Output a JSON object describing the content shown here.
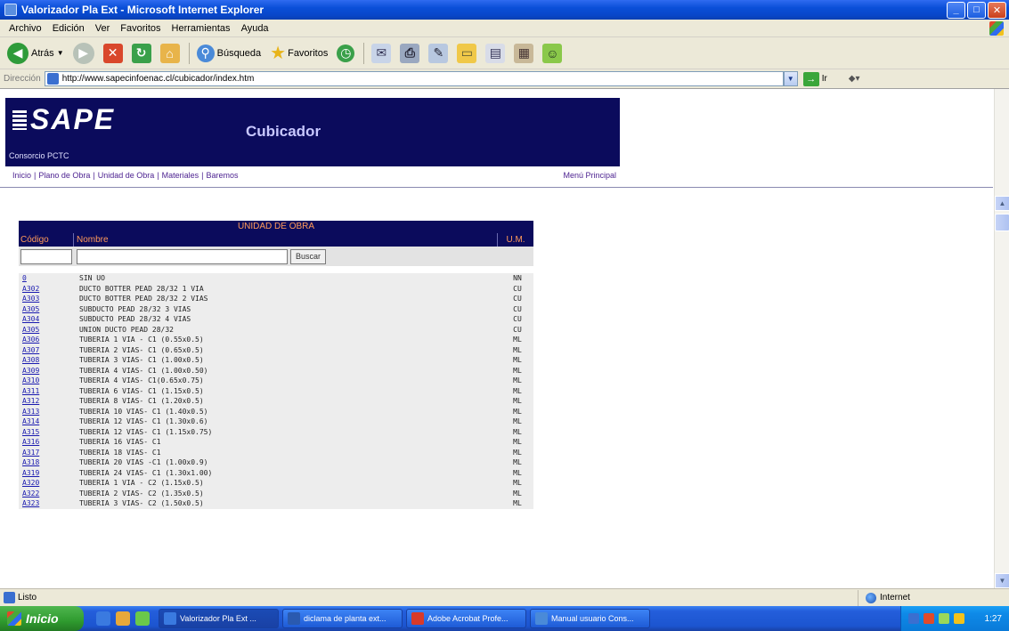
{
  "window": {
    "title": "Valorizador Pla Ext - Microsoft Internet Explorer"
  },
  "menubar": {
    "items": [
      "Archivo",
      "Edición",
      "Ver",
      "Favoritos",
      "Herramientas",
      "Ayuda"
    ]
  },
  "toolbar": {
    "back_label": "Atrás",
    "search_label": "Búsqueda",
    "favorites_label": "Favoritos"
  },
  "address": {
    "label": "Dirección",
    "url": "http://www.sapecinfoenac.cl/cubicador/index.htm",
    "go_label": "Ir"
  },
  "page": {
    "logo": "SAPE",
    "app_name": "Cubicador",
    "user": "Consorcio PCTC",
    "nav": [
      "Inicio",
      "Plano de Obra",
      "Unidad de Obra",
      "Materiales",
      "Baremos"
    ],
    "nav_main": "Menú Principal",
    "table": {
      "title": "UNIDAD DE OBRA",
      "headers": {
        "code": "Código",
        "name": "Nombre",
        "unit": "U.M."
      },
      "search_button": "Buscar",
      "rows": [
        {
          "code": "0",
          "name": "SIN UO",
          "unit": "NN"
        },
        {
          "code": "A302",
          "name": "DUCTO BOTTER PEAD 28/32 1 VIA",
          "unit": "CU"
        },
        {
          "code": "A303",
          "name": "DUCTO BOTTER PEAD 28/32 2 VIAS",
          "unit": "CU"
        },
        {
          "code": "A305",
          "name": "SUBDUCTO PEAD 28/32 3 VIAS",
          "unit": "CU"
        },
        {
          "code": "A304",
          "name": "SUBDUCTO PEAD 28/32 4 VIAS",
          "unit": "CU"
        },
        {
          "code": "A305",
          "name": "UNION DUCTO PEAD 28/32",
          "unit": "CU"
        },
        {
          "code": "A306",
          "name": "TUBERIA 1 VIA - C1 (0.55x0.5)",
          "unit": "ML"
        },
        {
          "code": "A307",
          "name": "TUBERIA 2 VIAS- C1 (0.65x0.5)",
          "unit": "ML"
        },
        {
          "code": "A308",
          "name": "TUBERIA 3 VIAS- C1 (1.00x0.5)",
          "unit": "ML"
        },
        {
          "code": "A309",
          "name": "TUBERIA 4 VIAS- C1 (1.00x0.50)",
          "unit": "ML"
        },
        {
          "code": "A310",
          "name": "TUBERIA 4 VIAS- C1(0.65x0.75)",
          "unit": "ML"
        },
        {
          "code": "A311",
          "name": "TUBERIA 6 VIAS- C1 (1.15x0.5)",
          "unit": "ML"
        },
        {
          "code": "A312",
          "name": "TUBERIA 8 VIAS- C1 (1.20x0.5)",
          "unit": "ML"
        },
        {
          "code": "A313",
          "name": "TUBERIA 10 VIAS- C1 (1.40x0.5)",
          "unit": "ML"
        },
        {
          "code": "A314",
          "name": "TUBERIA 12 VIAS- C1 (1.30x0.6)",
          "unit": "ML"
        },
        {
          "code": "A315",
          "name": "TUBERIA 12 VIAS- C1 (1.15x0.75)",
          "unit": "ML"
        },
        {
          "code": "A316",
          "name": "TUBERIA 16 VIAS- C1",
          "unit": "ML"
        },
        {
          "code": "A317",
          "name": "TUBERIA 18 VIAS- C1",
          "unit": "ML"
        },
        {
          "code": "A318",
          "name": "TUBERIA 20 VIAS -C1 (1.00x0.9)",
          "unit": "ML"
        },
        {
          "code": "A319",
          "name": "TUBERIA 24 VIAS- C1 (1.30x1.00)",
          "unit": "ML"
        },
        {
          "code": "A320",
          "name": "TUBERIA 1 VIA - C2 (1.15x0.5)",
          "unit": "ML"
        },
        {
          "code": "A322",
          "name": "TUBERIA 2 VIAS- C2 (1.35x0.5)",
          "unit": "ML"
        },
        {
          "code": "A323",
          "name": "TUBERIA 3 VIAS- C2 (1.50x0.5)",
          "unit": "ML"
        }
      ]
    }
  },
  "status": {
    "text": "Listo",
    "zone": "Internet"
  },
  "taskbar": {
    "start": "Inicio",
    "tasks": [
      "Valorizador Pla Ext ...",
      "diclama de planta ext...",
      "Adobe Acrobat Profe...",
      "Manual usuario Cons..."
    ],
    "clock": "1:27"
  }
}
